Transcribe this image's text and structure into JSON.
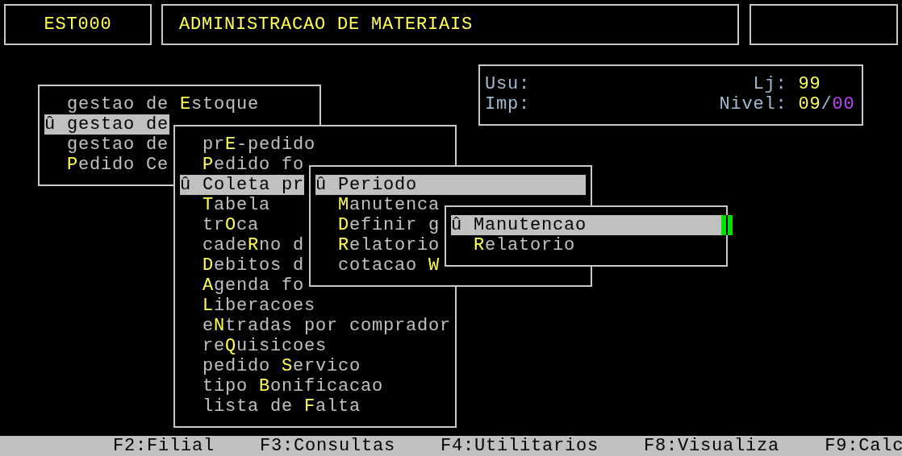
{
  "header": {
    "program_code": "EST000",
    "title": "ADMINISTRACAO DE MATERIAIS"
  },
  "info": {
    "rows": [
      {
        "label": "Usu:",
        "right_label": "Lj:",
        "value": "99"
      },
      {
        "label": "Imp:",
        "right_label": "Nivel:",
        "value": "09",
        "value_separator": "/",
        "value_suffix": "00"
      }
    ]
  },
  "menus": [
    {
      "items": [
        {
          "text": "gestao de **E**stoque",
          "selected": false
        },
        {
          "marker": "û",
          "text": "gestao de",
          "selected": true
        },
        {
          "text": "gestao de",
          "selected": false
        },
        {
          "text": "**P**edido Ce",
          "selected": false
        }
      ]
    },
    {
      "items": [
        {
          "text": "pr**E**-pedido",
          "selected": false
        },
        {
          "text": "**P**edido fo",
          "selected": false
        },
        {
          "marker": "û",
          "text": "Coleta pr",
          "selected": true
        },
        {
          "text": "**T**abela",
          "selected": false
        },
        {
          "text": "tr**O**ca",
          "selected": false
        },
        {
          "text": "cade**R**no d",
          "selected": false
        },
        {
          "text": "**D**ebitos d",
          "selected": false
        },
        {
          "text": "**A**genda fo",
          "selected": false
        },
        {
          "text": "**L**iberacoes",
          "selected": false
        },
        {
          "text": "e**N**tradas por comprador",
          "selected": false
        },
        {
          "text": "re**Q**uisicoes",
          "selected": false
        },
        {
          "text": "pedido **S**ervico",
          "selected": false
        },
        {
          "text": "tipo **B**onificacao",
          "selected": false
        },
        {
          "text": "lista de **F**alta",
          "selected": false
        }
      ]
    },
    {
      "items": [
        {
          "marker": "û",
          "text": "Periodo",
          "selected": true
        },
        {
          "text": "**M**anutenca",
          "selected": false
        },
        {
          "text": "**D**efinir g",
          "selected": false
        },
        {
          "text": "**R**elatorio",
          "selected": false
        },
        {
          "text": "cotacao **W**",
          "selected": false
        }
      ]
    },
    {
      "items": [
        {
          "marker": "û",
          "text": "Manutencao",
          "selected": true
        },
        {
          "text": "**R**elatorio",
          "selected": false
        }
      ]
    }
  ],
  "function_keys": [
    "F2:Filial",
    "F3:Consultas",
    "F4:Utilitarios",
    "F8:Visualiza",
    "F9:Calc"
  ]
}
